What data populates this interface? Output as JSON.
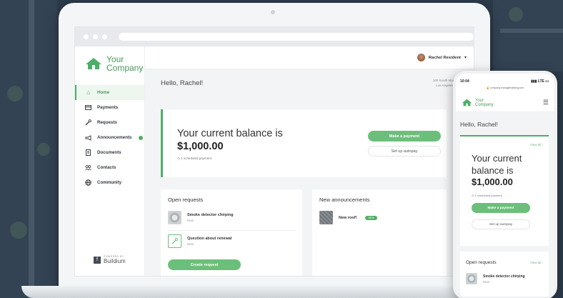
{
  "app": {
    "brand": {
      "line1": "Your",
      "line2": "Company"
    },
    "user_name": "Rachel Resident",
    "greeting": "Hello, Rachel!",
    "address": [
      "100 South Main Street - 1",
      "Los Angeles, CA 90012"
    ]
  },
  "sidebar": {
    "items": [
      {
        "label": "Home",
        "icon": "home-icon"
      },
      {
        "label": "Payments",
        "icon": "card-icon"
      },
      {
        "label": "Requests",
        "icon": "wrench-icon"
      },
      {
        "label": "Announcements",
        "icon": "megaphone-icon"
      },
      {
        "label": "Documents",
        "icon": "document-icon"
      },
      {
        "label": "Contacts",
        "icon": "contacts-icon"
      },
      {
        "label": "Community",
        "icon": "globe-icon"
      }
    ],
    "powered_by": "POWERED BY",
    "powered_name": "Buildium"
  },
  "balance": {
    "title": "Your current balance is",
    "amount": "$1,000.00",
    "scheduled": "1 scheduled payment",
    "make_payment": "Make a payment",
    "autopay": "Set up autopay"
  },
  "requests": {
    "title": "Open requests",
    "items": [
      {
        "title": "Smoke detector chirping",
        "status": "New"
      },
      {
        "title": "Question about renewal",
        "status": "New"
      }
    ],
    "create_button": "Create request"
  },
  "announcements": {
    "title": "New announcements",
    "items": [
      {
        "title": "New roof!",
        "tag": "NEW"
      }
    ]
  },
  "phone": {
    "time": "10:04",
    "signal": "LTE",
    "url": "company.managebuilding.com",
    "view_all": "View all",
    "balance_title": "Your current balance is",
    "open_requests": "Open requests",
    "request_title": "Smoke detector chirping",
    "request_status": "New"
  },
  "colors": {
    "accent": "#4caf68",
    "button": "#6bbf7b"
  }
}
